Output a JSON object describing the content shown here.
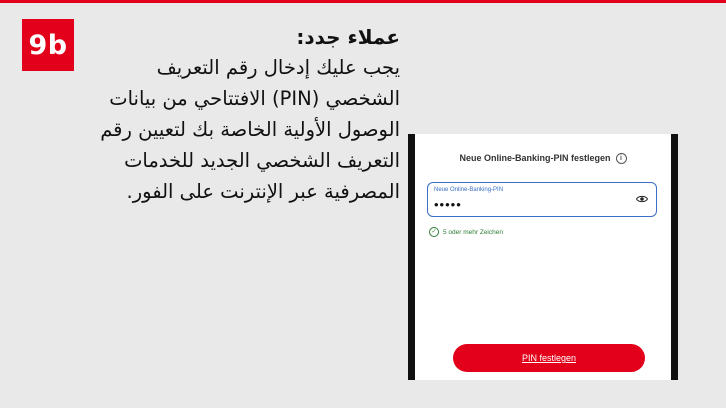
{
  "step": {
    "label": "9b"
  },
  "instructions": {
    "heading": "عملاء جدد:",
    "body": "يجب عليك إدخال رقم التعريف الشخصي (PIN) الافتتاحي من بيانات الوصول الأولية الخاصة بك لتعيين رقم التعريف الشخصي الجديد للخدمات المصرفية عبر الإنترنت على الفور."
  },
  "phone_screen": {
    "title": "Neue Online-Banking-PIN festlegen",
    "info_icon": "info-icon",
    "pin_field": {
      "label": "Neue Online-Banking-PIN",
      "value": "•••••",
      "toggle_icon": "eye-icon"
    },
    "hint": {
      "icon": "check-circle-icon",
      "text": "5 oder mehr Zeichen"
    },
    "submit_button": {
      "label": "PIN festlegen"
    }
  },
  "colors": {
    "brand_red": "#e2001a",
    "field_blue": "#3a6fc4",
    "success_green": "#2e7d32",
    "background": "#e9e9e9"
  }
}
